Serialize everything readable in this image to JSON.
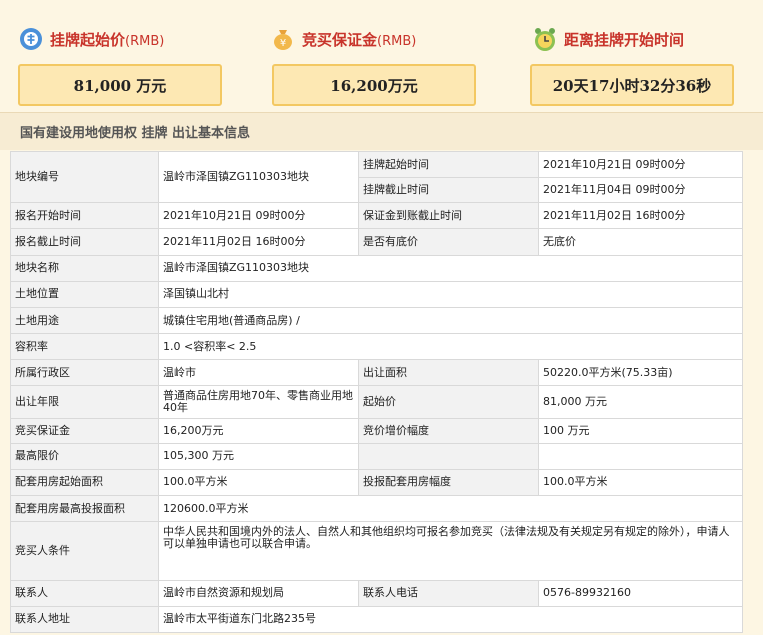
{
  "summary": {
    "start_price": {
      "label": "挂牌起始价",
      "suffix": "(RMB)",
      "value": "81,000 万元",
      "icon": "price-tag-icon"
    },
    "deposit": {
      "label": "竞买保证金",
      "suffix": "(RMB)",
      "value": "16,200万元",
      "icon": "money-bag-icon"
    },
    "countdown": {
      "label": "距离挂牌开始时间",
      "value": "20天17小时32分36秒",
      "icon": "alarm-clock-icon"
    }
  },
  "section_title": "国有建设用地使用权 挂牌 出让基本信息",
  "table": {
    "parcel_no_label": "地块编号",
    "parcel_no": "温岭市泽国镇ZG110303地块",
    "listing_start_label": "挂牌起始时间",
    "listing_start": "2021年10月21日 09时00分",
    "listing_end_label": "挂牌截止时间",
    "listing_end": "2021年11月04日 09时00分",
    "reg_start_label": "报名开始时间",
    "reg_start": "2021年10月21日 09时00分",
    "deposit_deadline_label": "保证金到账截止时间",
    "deposit_deadline": "2021年11月02日 16时00分",
    "reg_end_label": "报名截止时间",
    "reg_end": "2021年11月02日 16时00分",
    "reserve_label": "是否有底价",
    "reserve": "无底价",
    "parcel_name_label": "地块名称",
    "parcel_name": "温岭市泽国镇ZG110303地块",
    "location_label": "土地位置",
    "location": "泽国镇山北村",
    "use_label": "土地用途",
    "use": "城镇住宅用地(普通商品房) /",
    "far_label": "容积率",
    "far": "1.0 <容积率< 2.5",
    "district_label": "所属行政区",
    "district": "温岭市",
    "area_label": "出让面积",
    "area": "50220.0平方米(75.33亩)",
    "term_label": "出让年限",
    "term": "普通商品住房用地70年、零售商业用地40年",
    "start_price_label": "起始价",
    "start_price": "81,000 万元",
    "deposit_label": "竞买保证金",
    "deposit": "16,200万元",
    "increment_label": "竞价增价幅度",
    "increment": "100 万元",
    "max_price_label": "最高限价",
    "max_price": "105,300 万元",
    "housing_start_label": "配套用房起始面积",
    "housing_start": "100.0平方米",
    "housing_inc_label": "投报配套用房幅度",
    "housing_inc": "100.0平方米",
    "housing_max_label": "配套用房最高投报面积",
    "housing_max": "120600.0平方米",
    "bidder_label": "竞买人条件",
    "bidder": "中华人民共和国境内外的法人、自然人和其他组织均可报名参加竞买（法律法规及有关规定另有规定的除外），申请人可以单独申请也可以联合申请。",
    "contact_label": "联系人",
    "contact": "温岭市自然资源和规划局",
    "phone_label": "联系人电话",
    "phone": "0576-89932160",
    "address_label": "联系人地址",
    "address": "温岭市太平街道东门北路235号"
  }
}
